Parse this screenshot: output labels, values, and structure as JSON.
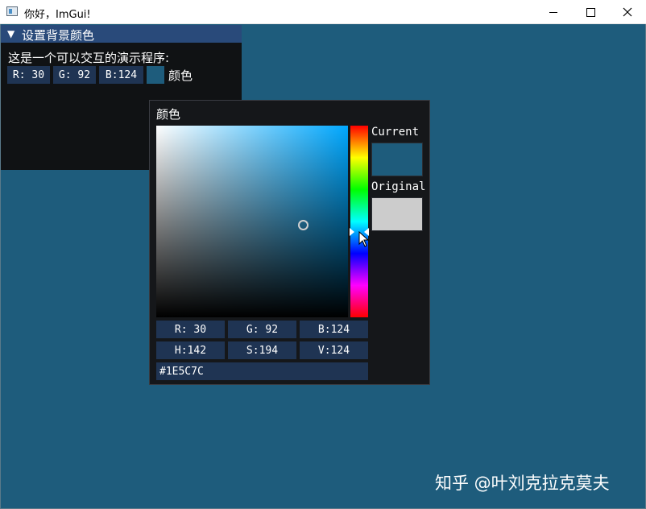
{
  "window": {
    "title": "你好，ImGui!"
  },
  "colors": {
    "background": "#1e5c7c",
    "original": "#cccccc",
    "frame": "#1f3453",
    "titlebar": "#294a7a"
  },
  "imgui_window": {
    "title": "设置背景颜色",
    "description": "这是一个可以交互的演示程序:",
    "rgb": {
      "r": "R: 30",
      "g": "G: 92",
      "b": "B:124"
    },
    "color_label": "颜色"
  },
  "picker": {
    "title": "颜色",
    "current_label": "Current",
    "original_label": "Original",
    "rgb": {
      "r": "R: 30",
      "g": "G: 92",
      "b": "B:124"
    },
    "hsv": {
      "h": "H:142",
      "s": "S:194",
      "v": "V:124"
    },
    "hex": "#1E5C7C"
  },
  "watermark": "知乎 @叶刘克拉克莫夫"
}
